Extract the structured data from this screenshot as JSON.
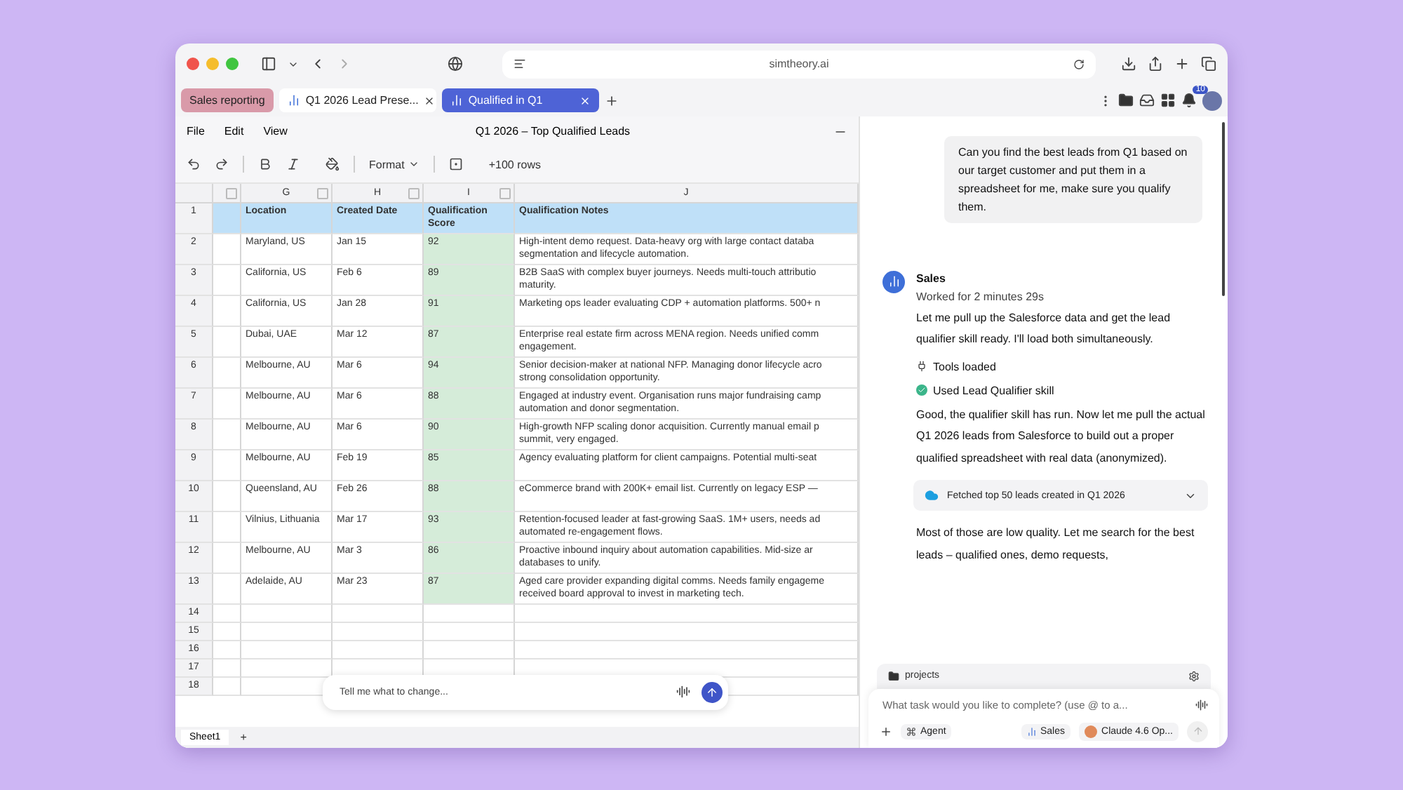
{
  "browser": {
    "address": "simtheory.ai"
  },
  "tabs": [
    {
      "kind": "group",
      "label": "Sales reporting",
      "selected": false
    },
    {
      "kind": "tab",
      "label": "Q1 2026 Lead Prese...",
      "selected": false
    },
    {
      "kind": "tab",
      "label": "Qualified in Q1",
      "selected": true
    }
  ],
  "notifications": {
    "count": "10"
  },
  "sheet": {
    "menu": [
      "File",
      "Edit",
      "View"
    ],
    "title": "Q1 2026 – Top Qualified Leads",
    "format_label": "Format",
    "add_rows": "+100 rows",
    "columns": [
      {
        "filter": true,
        "highlighted": false
      },
      {
        "letter": "G",
        "filter": true,
        "highlighted": false
      },
      {
        "letter": "H",
        "filter": true,
        "highlighted": false
      },
      {
        "letter": "I",
        "filter": true,
        "highlighted": true
      },
      {
        "letter": "J",
        "filter": false,
        "highlighted": false
      }
    ],
    "header": {
      "number": "1",
      "cells": [
        "",
        "Location",
        "Created Date",
        "Qualification Score",
        "Qualification Notes"
      ]
    },
    "rows": [
      {
        "number": "2",
        "location": "Maryland, US",
        "date": "Jan 15",
        "score": "92",
        "notes": [
          "High-intent demo request. Data-heavy org with large contact databa",
          "segmentation and lifecycle automation."
        ]
      },
      {
        "number": "3",
        "location": "California, US",
        "date": "Feb 6",
        "score": "89",
        "notes": [
          "B2B SaaS with complex buyer journeys. Needs multi-touch attributio",
          "maturity."
        ]
      },
      {
        "number": "4",
        "location": "California, US",
        "date": "Jan 28",
        "score": "91",
        "notes": [
          "Marketing ops leader evaluating CDP + automation platforms. 500+ n"
        ]
      },
      {
        "number": "5",
        "location": "Dubai, UAE",
        "date": "Mar 12",
        "score": "87",
        "notes": [
          "Enterprise real estate firm across MENA region. Needs unified comm",
          "engagement."
        ]
      },
      {
        "number": "6",
        "location": "Melbourne, AU",
        "date": "Mar 6",
        "score": "94",
        "notes": [
          "Senior decision-maker at national NFP. Managing donor lifecycle acro",
          "strong consolidation opportunity."
        ]
      },
      {
        "number": "7",
        "location": "Melbourne, AU",
        "date": "Mar 6",
        "score": "88",
        "notes": [
          "Engaged at industry event. Organisation runs major fundraising camp",
          "automation and donor segmentation."
        ]
      },
      {
        "number": "8",
        "location": "Melbourne, AU",
        "date": "Mar 6",
        "score": "90",
        "notes": [
          "High-growth NFP scaling donor acquisition. Currently manual email p",
          "summit, very engaged."
        ]
      },
      {
        "number": "9",
        "location": "Melbourne, AU",
        "date": "Feb 19",
        "score": "85",
        "notes": [
          "Agency evaluating platform for client campaigns. Potential multi-seat"
        ]
      },
      {
        "number": "10",
        "location": "Queensland, AU",
        "date": "Feb 26",
        "score": "88",
        "notes": [
          "eCommerce brand with 200K+ email list. Currently on legacy ESP —"
        ]
      },
      {
        "number": "11",
        "location": "Vilnius, Lithuania",
        "date": "Mar 17",
        "score": "93",
        "notes": [
          "Retention-focused leader at fast-growing SaaS. 1M+ users, needs ad",
          "automated re-engagement flows."
        ]
      },
      {
        "number": "12",
        "location": "Melbourne, AU",
        "date": "Mar 3",
        "score": "86",
        "notes": [
          "Proactive inbound inquiry about automation capabilities. Mid-size ar",
          "databases to unify."
        ]
      },
      {
        "number": "13",
        "location": "Adelaide, AU",
        "date": "Mar 23",
        "score": "87",
        "notes": [
          "Aged care provider expanding digital comms. Needs family engageme",
          "received board approval to invest in marketing tech."
        ]
      },
      {
        "number": "14"
      },
      {
        "number": "15"
      },
      {
        "number": "16"
      },
      {
        "number": "17"
      },
      {
        "number": "18"
      }
    ],
    "sheet_tabs": [
      {
        "label": "Sheet1",
        "selected": true
      }
    ],
    "add_sheet": "+",
    "edit_prompt": {
      "placeholder": "Tell me what to change..."
    }
  },
  "chat": {
    "user_message": "Can you find the best leads from Q1 based on our target customer and put them in a spreadsheet for me, make sure you qualify them.",
    "agent": {
      "name": "Sales",
      "status": "Worked for 2 minutes 29s"
    },
    "items": [
      {
        "kind": "text",
        "text": "Let me pull up the Salesforce data and get the lead qualifier skill ready. I'll load both simultaneously."
      },
      {
        "kind": "tools",
        "text": "Tools loaded"
      },
      {
        "kind": "skill",
        "text": "Used Lead Qualifier skill"
      },
      {
        "kind": "text",
        "text": "Good, the qualifier skill has run. Now let me pull the actual Q1 2026 leads from Salesforce to build out a proper qualified spreadsheet with real data (anonymized)."
      },
      {
        "kind": "fetch",
        "text": "Fetched top 50 leads created in Q1 2026"
      },
      {
        "kind": "text",
        "text": "Most of those are low quality. Let me search for the best leads – qualified ones, demo requests,"
      }
    ],
    "composer": {
      "folder": "projects",
      "placeholder": "What task would you like to complete? (use @ to a...",
      "mode": "Agent",
      "assistant": "Sales",
      "model": "Claude 4.6 Op..."
    }
  }
}
